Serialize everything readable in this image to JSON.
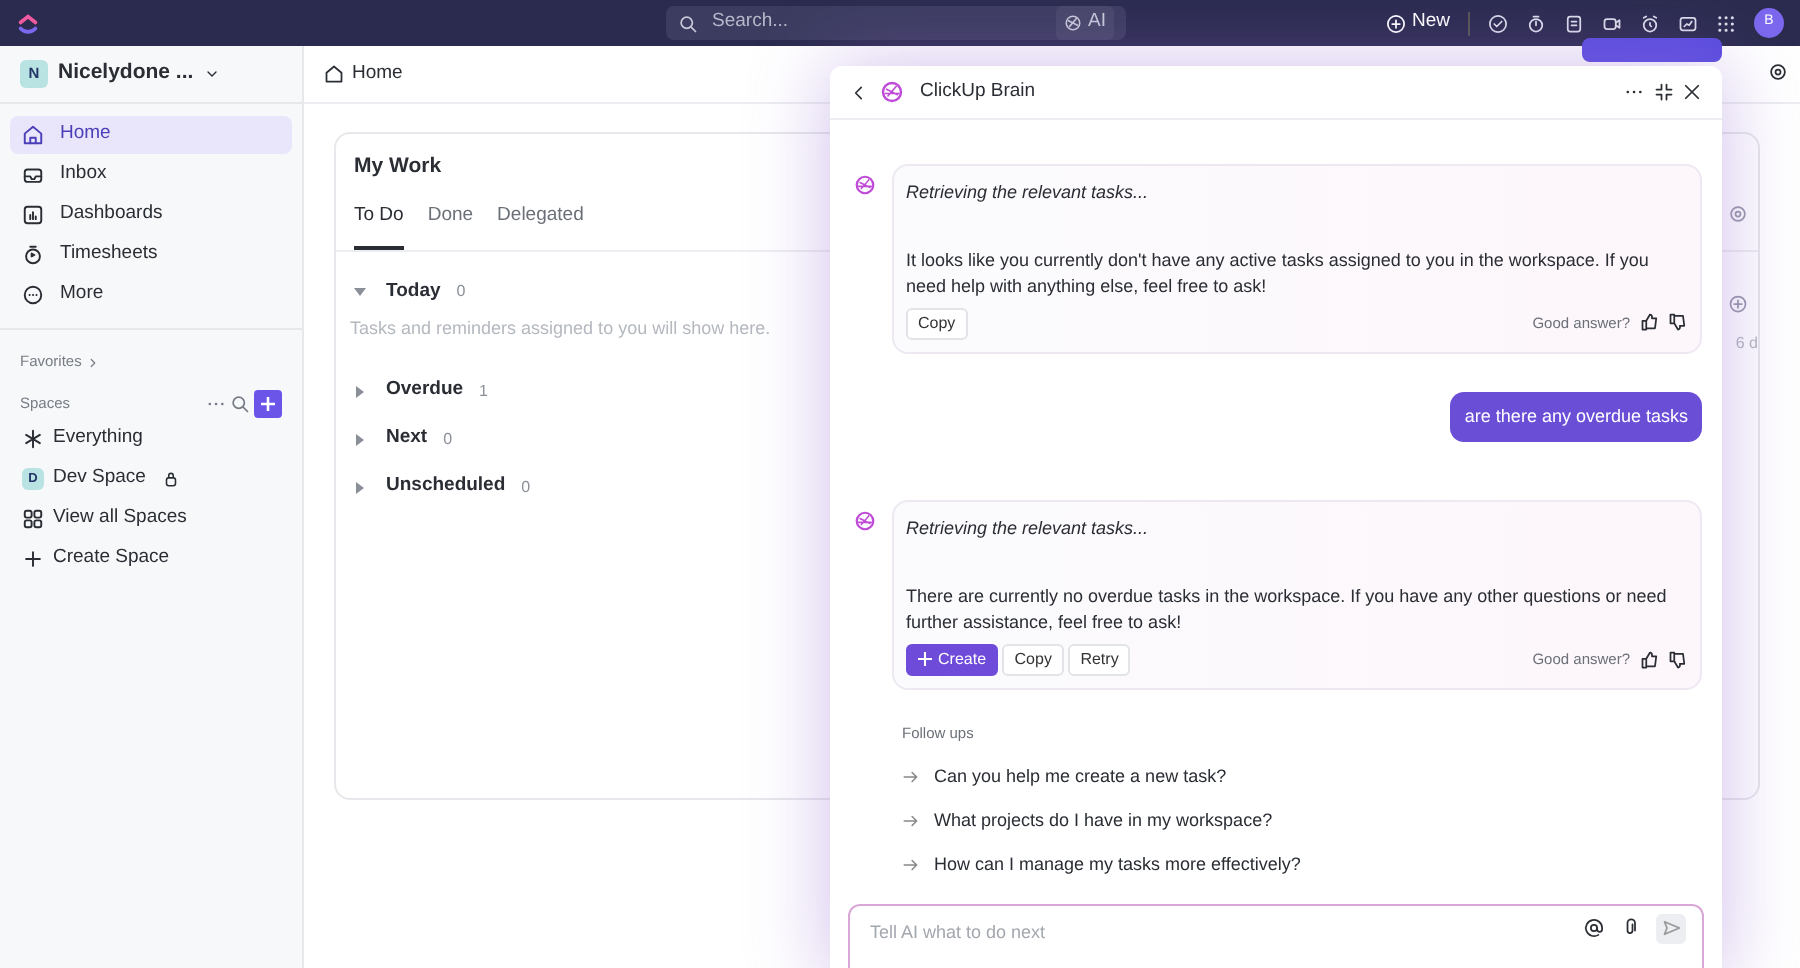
{
  "topbar": {
    "search": {
      "placeholder": "Search..."
    },
    "ai_button": "AI",
    "new_button": "New",
    "avatar": "B"
  },
  "sidebar": {
    "workspace": {
      "initial": "N",
      "name": "Nicelydone ..."
    },
    "items": [
      {
        "label": "Home",
        "selected": true
      },
      {
        "label": "Inbox",
        "selected": false
      },
      {
        "label": "Dashboards",
        "selected": false
      },
      {
        "label": "Timesheets",
        "selected": false
      },
      {
        "label": "More",
        "selected": false
      }
    ],
    "favorites": "Favorites",
    "spaces_label": "Spaces",
    "spaces": [
      {
        "label": "Everything",
        "kind": "everything"
      },
      {
        "label": "Dev Space",
        "kind": "space",
        "initial": "D",
        "locked": true
      },
      {
        "label": "View all Spaces",
        "kind": "grid"
      },
      {
        "label": "Create Space",
        "kind": "create"
      }
    ]
  },
  "breadcrumb": "Home",
  "my_work": {
    "title": "My Work",
    "tabs": [
      {
        "label": "To Do",
        "selected": true
      },
      {
        "label": "Done",
        "selected": false
      },
      {
        "label": "Delegated",
        "selected": false
      }
    ],
    "groups": [
      {
        "label": "Today",
        "count": "0",
        "expanded": true,
        "empty_text": "Tasks and reminders assigned to you will show here."
      },
      {
        "label": "Overdue",
        "count": "1",
        "expanded": false
      },
      {
        "label": "Next",
        "count": "0",
        "expanded": false
      },
      {
        "label": "Unscheduled",
        "count": "0",
        "expanded": false
      }
    ]
  },
  "behind": {
    "cut_text": "6 d"
  },
  "brain_panel": {
    "title": "ClickUp Brain",
    "messages": [
      {
        "kind": "ai",
        "status": "Retrieving the relevant tasks...",
        "text": "It looks like you currently don't have any active tasks assigned to you in the workspace. If you need help with anything else, feel free to ask!",
        "actions": [
          {
            "label": "Copy",
            "kind": "plain"
          }
        ],
        "feedback": "Good answer?"
      },
      {
        "kind": "user",
        "text": "are there any overdue tasks"
      },
      {
        "kind": "ai",
        "status": "Retrieving the relevant tasks...",
        "text": "There are currently no overdue tasks in the workspace. If you have any other questions or need further assistance, feel free to ask!",
        "actions": [
          {
            "label": "Create",
            "kind": "primary"
          },
          {
            "label": "Copy",
            "kind": "plain"
          },
          {
            "label": "Retry",
            "kind": "plain"
          }
        ],
        "feedback": "Good answer?"
      }
    ],
    "follow_ups_label": "Follow ups",
    "follow_ups": [
      "Can you help me create a new task?",
      "What projects do I have in my workspace?",
      "How can I manage my tasks more effectively?"
    ],
    "input": {
      "placeholder": "Tell AI what to do next"
    }
  }
}
